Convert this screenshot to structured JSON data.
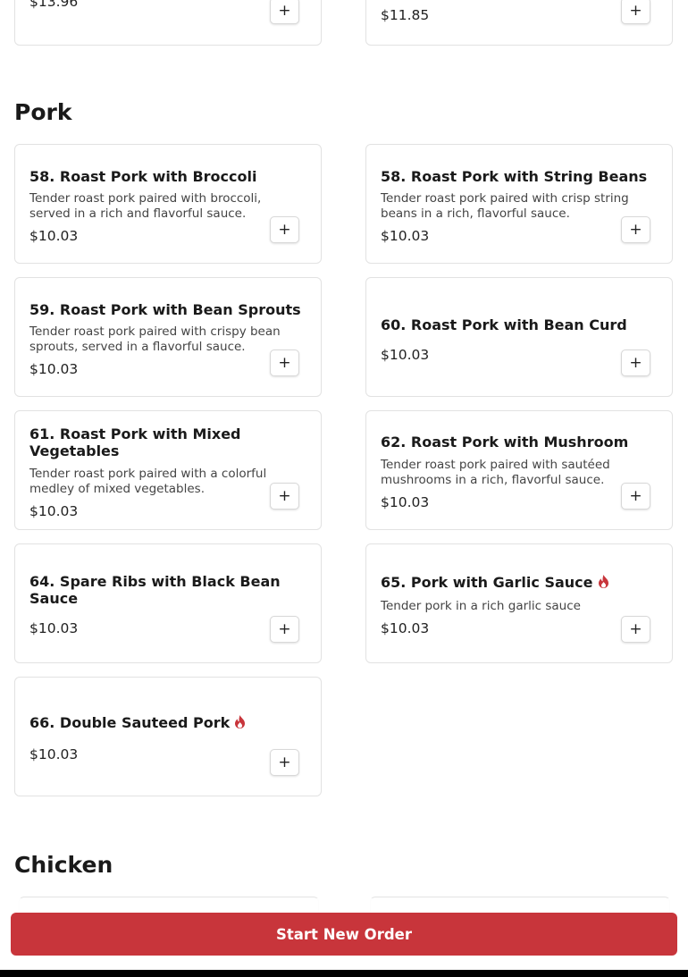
{
  "top_partial": {
    "left_price": "$13.96",
    "right_price": "$11.85",
    "right_title_partial": "..."
  },
  "sections": {
    "pork": {
      "title": "Pork"
    },
    "chicken": {
      "title": "Chicken"
    }
  },
  "items": [
    {
      "title": "58. Roast Pork with Broccoli",
      "desc": "Tender roast pork paired with broccoli, served in a rich and flavorful sauce.",
      "price": "$10.03"
    },
    {
      "title": "58. Roast Pork with String Beans",
      "desc": "Tender roast pork paired with crisp string beans in a rich, flavorful sauce.",
      "price": "$10.03"
    },
    {
      "title": "59. Roast Pork with Bean Sprouts",
      "desc": "Tender roast pork paired with crispy bean sprouts, served in a flavorful sauce.",
      "price": "$10.03"
    },
    {
      "title": "60. Roast Pork with Bean Curd",
      "desc": "",
      "price": "$10.03"
    },
    {
      "title": "61. Roast Pork with Mixed Vegetables",
      "desc": "Tender roast pork paired with a colorful medley of mixed vegetables.",
      "price": "$10.03"
    },
    {
      "title": "62. Roast Pork with Mushroom",
      "desc": "Tender roast pork paired with sautéed mushrooms in a rich, flavorful sauce.",
      "price": "$10.03"
    },
    {
      "title": "64. Spare Ribs with Black Bean Sauce",
      "desc": "",
      "price": "$10.03"
    },
    {
      "title": "65. Pork with Garlic Sauce",
      "desc": "Tender pork in a rich garlic sauce",
      "price": "$10.03",
      "spicy": true
    },
    {
      "title": "66. Double Sauteed Pork",
      "desc": "",
      "price": "$10.03",
      "spicy": true
    }
  ],
  "add_button_label": "+",
  "order_button": {
    "label": "Start New Order"
  },
  "icons": {
    "add": "plus-icon",
    "spicy": "fire-icon"
  },
  "colors": {
    "accent": "#c8353b",
    "spicy": "#c8353b"
  }
}
